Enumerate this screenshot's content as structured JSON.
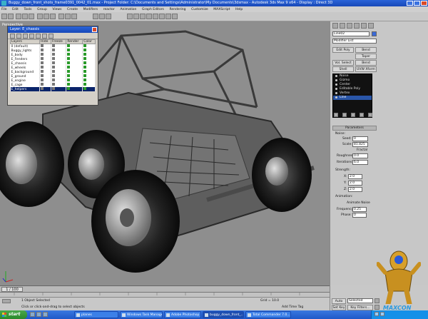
{
  "window": {
    "title": "Buggy_down_front_shots_frame0391_0042_01.max - Project Folder: C:\\Documents and Settings\\Administrator\\My Documents\\3dsmax - Autodesk 3ds Max 9 x64 - Display : Direct 3D"
  },
  "menu": [
    "File",
    "Edit",
    "Tools",
    "Group",
    "Views",
    "Create",
    "Modifiers",
    "reactor",
    "Animation",
    "Graph Editors",
    "Rendering",
    "Customize",
    "MAXScript",
    "Help"
  ],
  "viewport": {
    "label": "Perspective"
  },
  "layers_dialog": {
    "title": "Layer: E_chassis",
    "columns": [
      "Layers",
      "Hide",
      "Freeze",
      "Render",
      "Color"
    ],
    "rows": [
      {
        "name": "0 (default)",
        "selected": false
      },
      {
        "name": "Buggy_lights",
        "selected": false
      },
      {
        "name": "E_body",
        "selected": false
      },
      {
        "name": "E_Fenders",
        "selected": false
      },
      {
        "name": "E_chassis",
        "selected": false
      },
      {
        "name": "E_wheels",
        "selected": false
      },
      {
        "name": "E_background",
        "selected": false
      },
      {
        "name": "E_ground",
        "selected": false
      },
      {
        "name": "E_engine",
        "selected": false
      },
      {
        "name": "E_cage",
        "selected": false
      },
      {
        "name": "E_helpers",
        "selected": true
      }
    ]
  },
  "command_panel": {
    "object_name": "Line02",
    "modifier_list": "Modifier List",
    "buttons": [
      "Edit Poly",
      "Bend",
      "Taper",
      "Vol. Select",
      "Bend",
      "Shell",
      "UVW Xform"
    ],
    "stack": [
      {
        "name": "Noise",
        "selected": false
      },
      {
        "name": "Gizmo",
        "selected": false
      },
      {
        "name": "Center",
        "selected": false
      },
      {
        "name": "Editable Poly",
        "selected": false
      },
      {
        "name": "Vertex",
        "selected": false
      },
      {
        "name": "Line",
        "selected": true
      }
    ],
    "parameters_rollout": "Parameters",
    "noise_label": "Noise:",
    "seed_label": "Seed:",
    "seed_value": "0",
    "scale_label": "Scale:",
    "scale_value": "81.825",
    "fractal_label": "Fractal",
    "roughness_label": "Roughness:",
    "roughness_value": "0.0",
    "iterations_label": "Iterations:",
    "iterations_value": "6.0",
    "strength_label": "Strength:",
    "x_label": "X:",
    "x_value": "2.0",
    "y_label": "Y:",
    "y_value": "2.0",
    "z_label": "Z:",
    "z_value": "2.0",
    "animation_label": "Animation:",
    "animate_noise_label": "Animate Noise",
    "frequency_label": "Frequency:",
    "frequency_value": "0.25",
    "phase_label": "Phase:",
    "phase_value": "0"
  },
  "timeline": {
    "frame": "1 / 100"
  },
  "status": {
    "selection": "1 Object Selected",
    "prompt": "Click or click-and-drag to select objects",
    "grid": "Grid = 10.0",
    "add_time_tag": "Add Time Tag",
    "auto_key": "Auto Key",
    "set_key": "Set Key",
    "selected": "Selected",
    "key_filters": "Key Filters..."
  },
  "taskbar": {
    "start": "start",
    "tasks": [
      "planes",
      "Windows Task Manager",
      "Adobe Photoshop CS",
      "buggy_down_front_...",
      "Total Commander 7.0..."
    ]
  },
  "watermark": "MAXCON"
}
